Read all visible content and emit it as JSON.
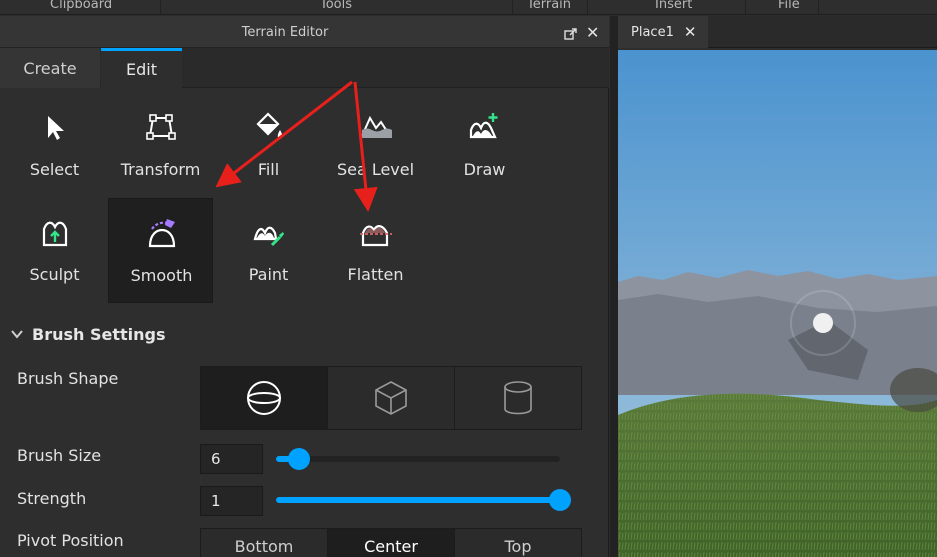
{
  "ribbon": {
    "groups": [
      "Clipboard",
      "Tools",
      "Terrain",
      "Insert",
      "File"
    ]
  },
  "panel": {
    "title": "Terrain Editor",
    "tabs": [
      "Create",
      "Edit"
    ],
    "active_tab": "Edit"
  },
  "tools": {
    "select": "Select",
    "transform": "Transform",
    "fill": "Fill",
    "sea_level": "Sea Level",
    "draw": "Draw",
    "sculpt": "Sculpt",
    "smooth": "Smooth",
    "paint": "Paint",
    "flatten": "Flatten",
    "selected": "Smooth"
  },
  "brush_settings": {
    "title": "Brush Settings",
    "shape_label": "Brush Shape",
    "shapes": [
      "sphere-icon",
      "cube-icon",
      "cylinder-icon"
    ],
    "active_shape": "sphere",
    "size_label": "Brush Size",
    "size_value": "6",
    "size_fraction": 0.08,
    "strength_label": "Strength",
    "strength_value": "1",
    "strength_fraction": 1.0,
    "pivot_label": "Pivot Position",
    "pivot_options": [
      "Bottom",
      "Center",
      "Top"
    ],
    "pivot_active": "Center"
  },
  "viewport": {
    "tab_label": "Place1"
  },
  "colors": {
    "accent": "#00a2ff",
    "annotation_arrow": "#e8201c",
    "smooth_accent": "#a77bff",
    "draw_accent": "#34e38a",
    "flatten_accent": "#e06666"
  }
}
